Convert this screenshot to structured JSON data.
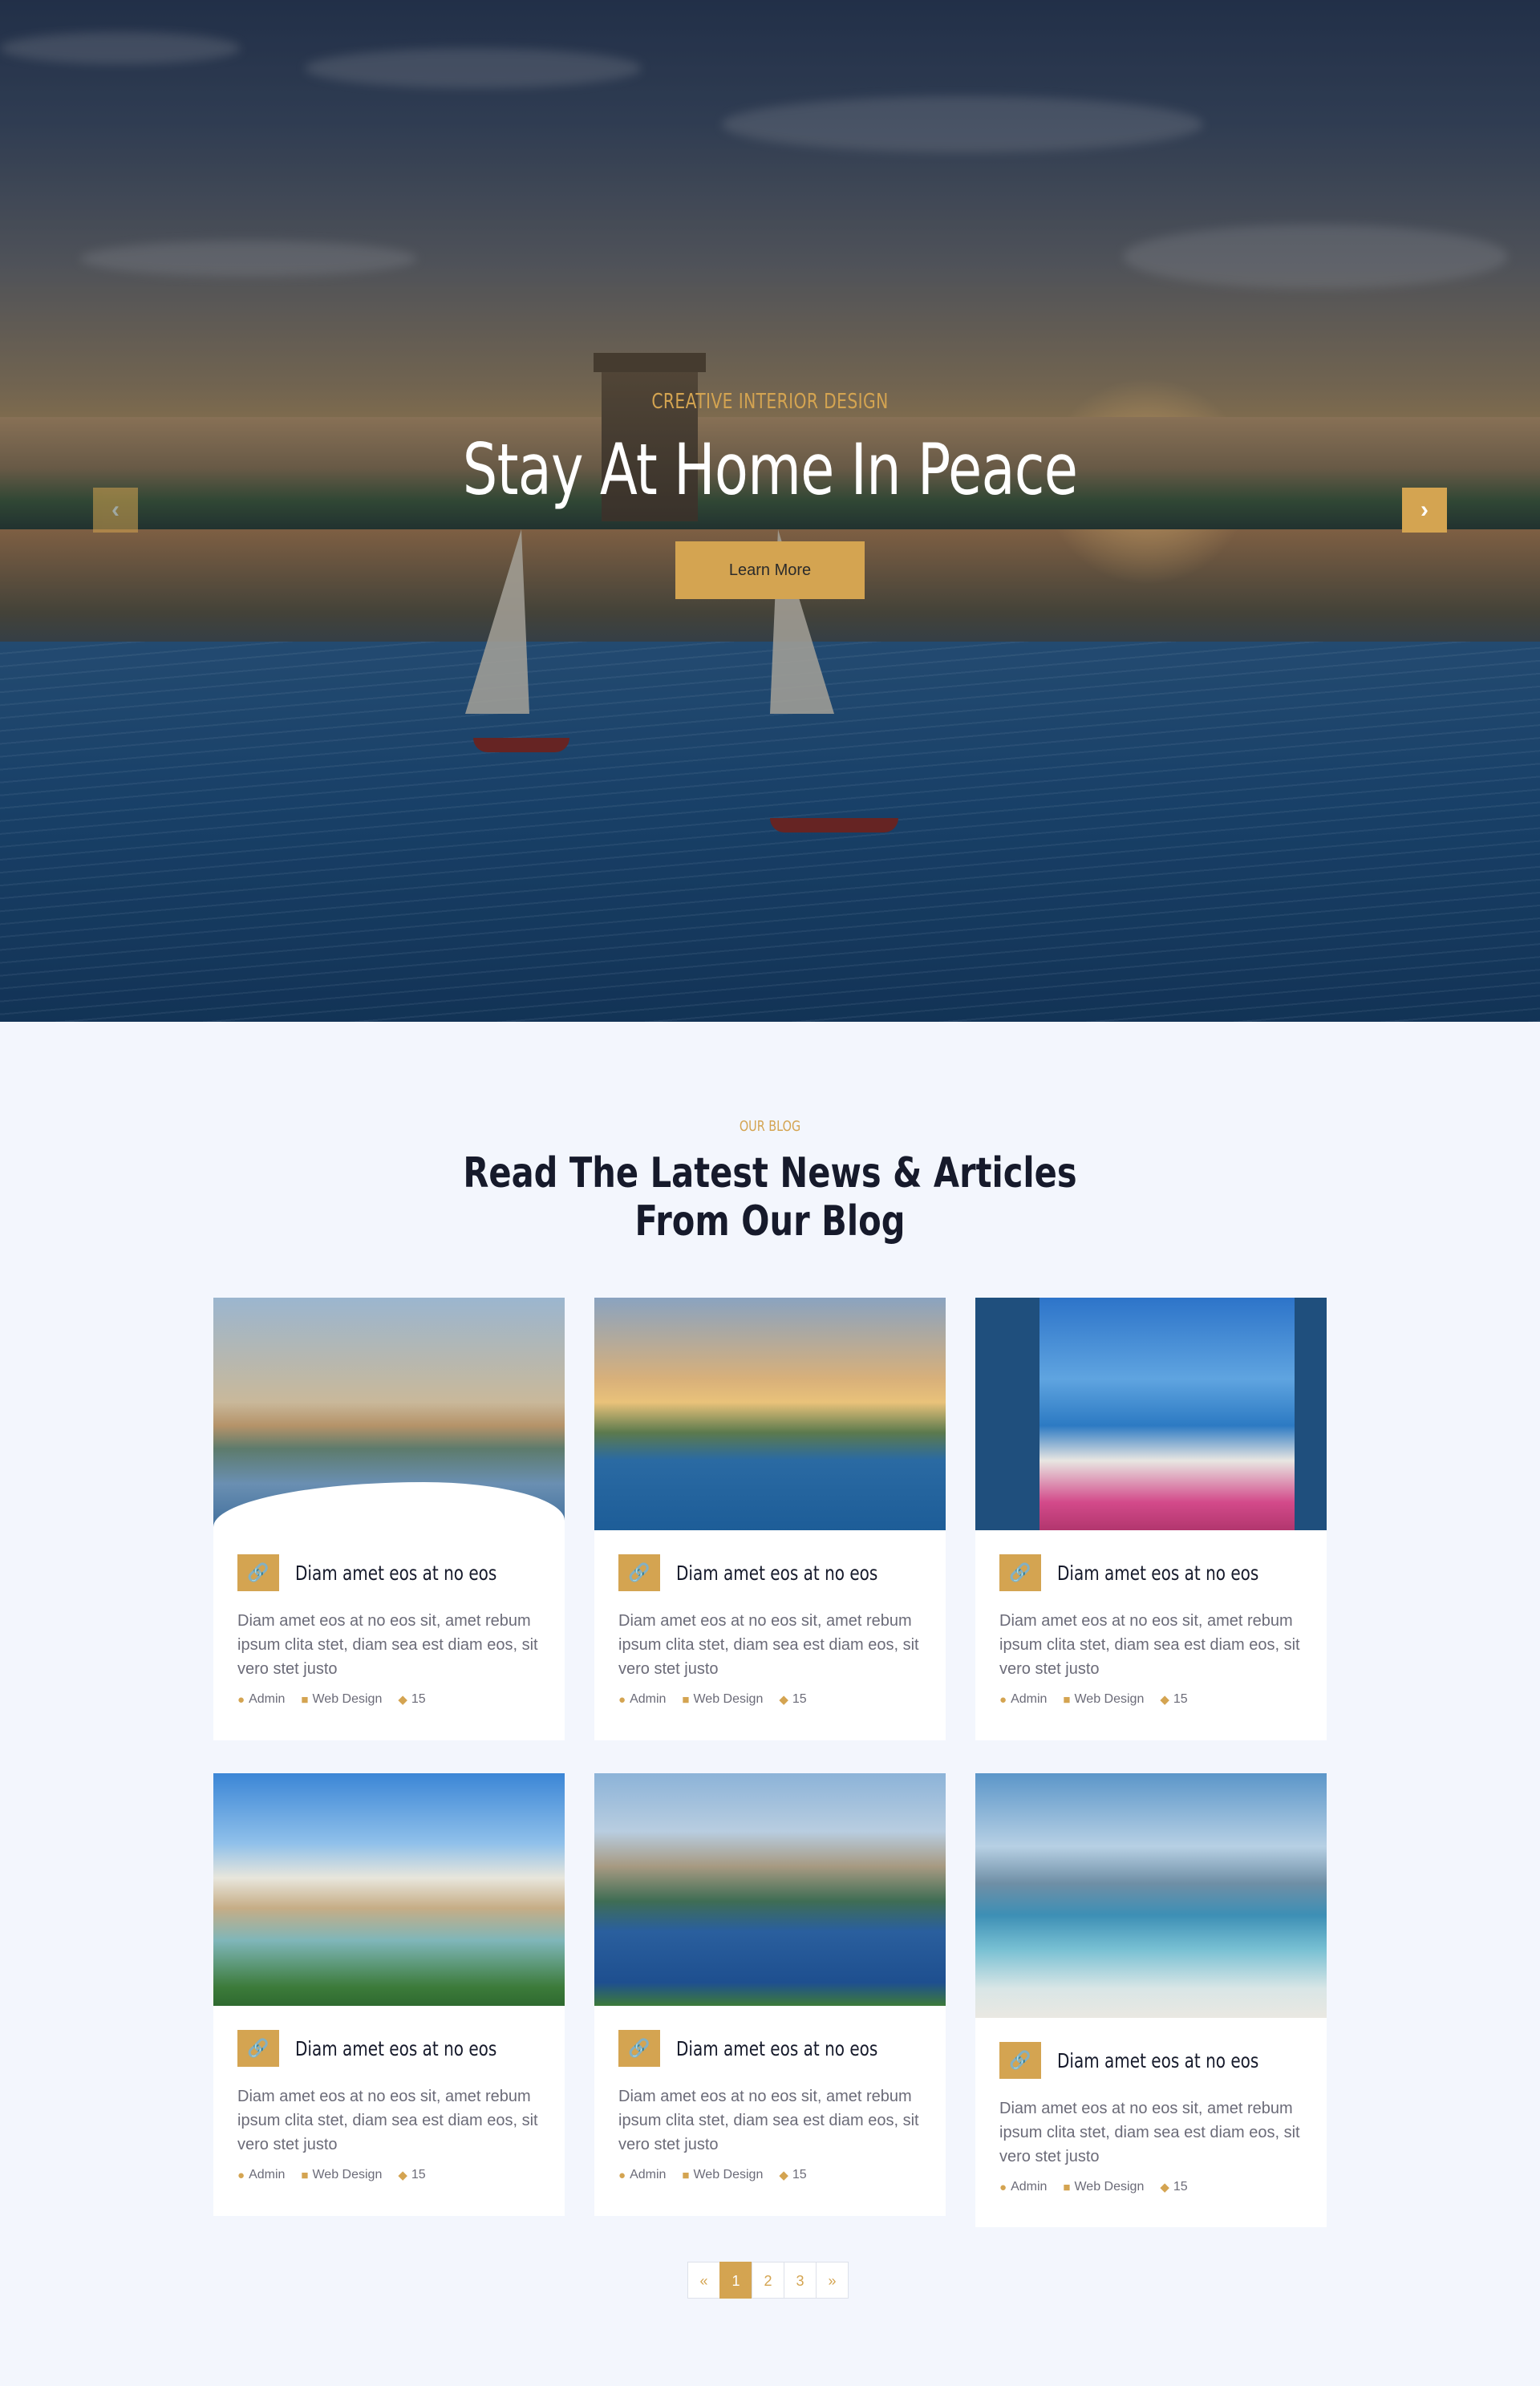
{
  "hero": {
    "subtitle": "CREATIVE INTERIOR DESIGN",
    "title": "Stay At Home In Peace",
    "button": "Learn More",
    "prev_glyph": "‹",
    "next_glyph": "›"
  },
  "blog": {
    "tag": "OUR BLOG",
    "title_line1": "Read The Latest News & Articles",
    "title_line2": "From Our Blog",
    "posts": [
      {
        "title": "Diam amet eos at no eos",
        "text": "Diam amet eos at no eos sit, amet rebum ipsum clita stet, diam sea est diam eos, sit vero stet justo",
        "author": "Admin",
        "category": "Web Design",
        "comments": "15"
      },
      {
        "title": "Diam amet eos at no eos",
        "text": "Diam amet eos at no eos sit, amet rebum ipsum clita stet, diam sea est diam eos, sit vero stet justo",
        "author": "Admin",
        "category": "Web Design",
        "comments": "15"
      },
      {
        "title": "Diam amet eos at no eos",
        "text": "Diam amet eos at no eos sit, amet rebum ipsum clita stet, diam sea est diam eos, sit vero stet justo",
        "author": "Admin",
        "category": "Web Design",
        "comments": "15"
      },
      {
        "title": "Diam amet eos at no eos",
        "text": "Diam amet eos at no eos sit, amet rebum ipsum clita stet, diam sea est diam eos, sit vero stet justo",
        "author": "Admin",
        "category": "Web Design",
        "comments": "15"
      },
      {
        "title": "Diam amet eos at no eos",
        "text": "Diam amet eos at no eos sit, amet rebum ipsum clita stet, diam sea est diam eos, sit vero stet justo",
        "author": "Admin",
        "category": "Web Design",
        "comments": "15"
      },
      {
        "title": "Diam amet eos at no eos",
        "text": "Diam amet eos at no eos sit, amet rebum ipsum clita stet, diam sea est diam eos, sit vero stet justo",
        "author": "Admin",
        "category": "Web Design",
        "comments": "15"
      }
    ]
  },
  "pagination": {
    "prev": "«",
    "pages": [
      "1",
      "2",
      "3"
    ],
    "next": "»",
    "active": "1"
  },
  "icons": {
    "post": "link-icon",
    "author": "user-icon",
    "category": "folder-icon",
    "comments": "comments-icon"
  },
  "colors": {
    "accent": "#d4a451",
    "background": "#f3f6fd",
    "heading": "#161a2b"
  }
}
